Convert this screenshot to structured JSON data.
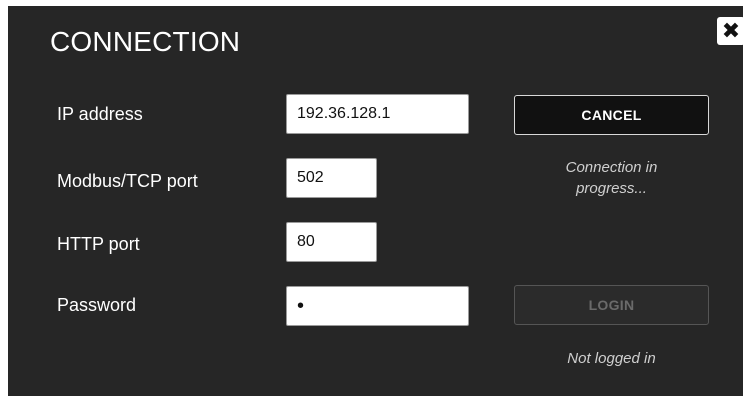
{
  "dialog": {
    "title": "CONNECTION",
    "close_icon": "close-icon"
  },
  "fields": {
    "ip": {
      "label": "IP address",
      "value": "192.36.128.1"
    },
    "modbus": {
      "label": "Modbus/TCP port",
      "value": "502"
    },
    "http": {
      "label": "HTTP port",
      "value": "80"
    },
    "password": {
      "label": "Password",
      "value": "•"
    }
  },
  "actions": {
    "cancel_label": "CANCEL",
    "login_label": "LOGIN"
  },
  "status": {
    "connection_line1": "Connection in",
    "connection_line2": "progress...",
    "login_status": "Not logged in"
  },
  "colors": {
    "background": "#262626",
    "text": "#ffffff",
    "disabled_text": "#6a6a6a"
  }
}
